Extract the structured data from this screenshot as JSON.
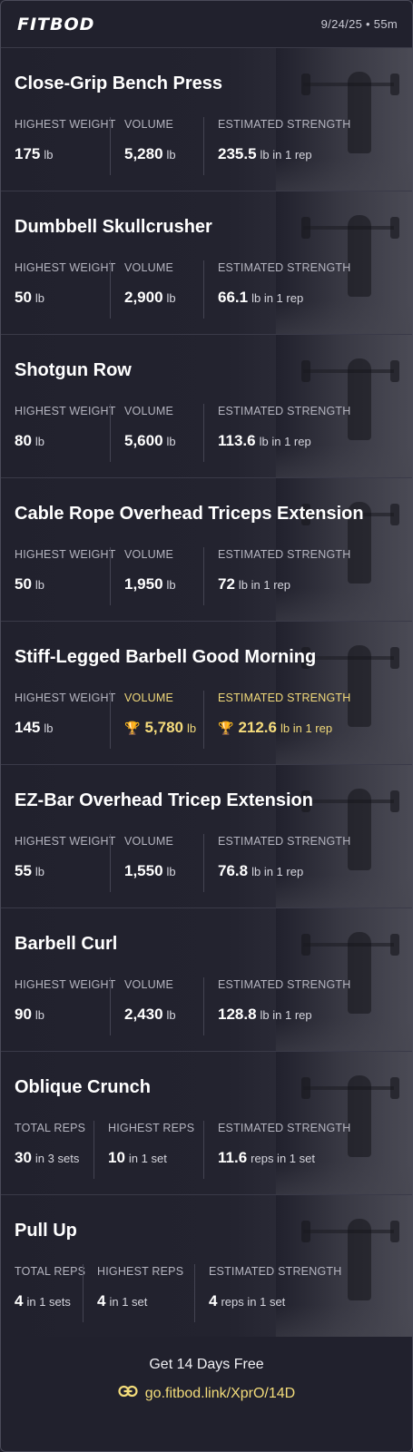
{
  "header": {
    "logo": "FITBOD",
    "meta": "9/24/25 • 55m"
  },
  "exercises": [
    {
      "name": "Close-Grip Bench Press",
      "stats": [
        {
          "label": "HIGHEST WEIGHT",
          "value": "175",
          "unit": "lb"
        },
        {
          "label": "VOLUME",
          "value": "5,280",
          "unit": "lb"
        },
        {
          "label": "ESTIMATED STRENGTH",
          "value": "235.5",
          "unit": "lb in 1 rep"
        }
      ]
    },
    {
      "name": "Dumbbell Skullcrusher",
      "stats": [
        {
          "label": "HIGHEST WEIGHT",
          "value": "50",
          "unit": "lb"
        },
        {
          "label": "VOLUME",
          "value": "2,900",
          "unit": "lb"
        },
        {
          "label": "ESTIMATED STRENGTH",
          "value": "66.1",
          "unit": "lb in 1 rep"
        }
      ]
    },
    {
      "name": "Shotgun Row",
      "stats": [
        {
          "label": "HIGHEST WEIGHT",
          "value": "80",
          "unit": "lb"
        },
        {
          "label": "VOLUME",
          "value": "5,600",
          "unit": "lb"
        },
        {
          "label": "ESTIMATED STRENGTH",
          "value": "113.6",
          "unit": "lb in 1 rep"
        }
      ]
    },
    {
      "name": "Cable Rope Overhead Triceps Extension",
      "stats": [
        {
          "label": "HIGHEST WEIGHT",
          "value": "50",
          "unit": "lb"
        },
        {
          "label": "VOLUME",
          "value": "1,950",
          "unit": "lb"
        },
        {
          "label": "ESTIMATED STRENGTH",
          "value": "72",
          "unit": "lb in 1 rep"
        }
      ]
    },
    {
      "name": "Stiff-Legged Barbell Good Morning",
      "stats": [
        {
          "label": "HIGHEST WEIGHT",
          "value": "145",
          "unit": "lb"
        },
        {
          "label": "VOLUME",
          "value": "5,780",
          "unit": "lb",
          "record": true
        },
        {
          "label": "ESTIMATED STRENGTH",
          "value": "212.6",
          "unit": "lb in 1 rep",
          "record": true
        }
      ]
    },
    {
      "name": "EZ-Bar Overhead Tricep Extension",
      "stats": [
        {
          "label": "HIGHEST WEIGHT",
          "value": "55",
          "unit": "lb"
        },
        {
          "label": "VOLUME",
          "value": "1,550",
          "unit": "lb"
        },
        {
          "label": "ESTIMATED STRENGTH",
          "value": "76.8",
          "unit": "lb in 1 rep"
        }
      ]
    },
    {
      "name": "Barbell Curl",
      "stats": [
        {
          "label": "HIGHEST WEIGHT",
          "value": "90",
          "unit": "lb"
        },
        {
          "label": "VOLUME",
          "value": "2,430",
          "unit": "lb"
        },
        {
          "label": "ESTIMATED STRENGTH",
          "value": "128.8",
          "unit": "lb in 1 rep"
        }
      ]
    },
    {
      "name": "Oblique Crunch",
      "stats": [
        {
          "label": "TOTAL REPS",
          "value": "30",
          "unit": "in 3 sets"
        },
        {
          "label": "HIGHEST REPS",
          "value": "10",
          "unit": "in 1 set"
        },
        {
          "label": "ESTIMATED STRENGTH",
          "value": "11.6",
          "unit": "reps in 1 set"
        }
      ]
    },
    {
      "name": "Pull Up",
      "stats": [
        {
          "label": "TOTAL REPS",
          "value": "4",
          "unit": "in 1 sets"
        },
        {
          "label": "HIGHEST REPS",
          "value": "4",
          "unit": "in 1 set"
        },
        {
          "label": "ESTIMATED STRENGTH",
          "value": "4",
          "unit": "reps in 1 set"
        }
      ]
    }
  ],
  "footer": {
    "cta": "Get 14 Days Free",
    "link": "go.fitbod.link/XprO/14D"
  },
  "colors": {
    "background": "#21212d",
    "accent_gold": "#f3dc7a",
    "divider": "#3a3a48"
  },
  "icons": {
    "trophy": "trophy-icon",
    "link": "link-icon"
  }
}
